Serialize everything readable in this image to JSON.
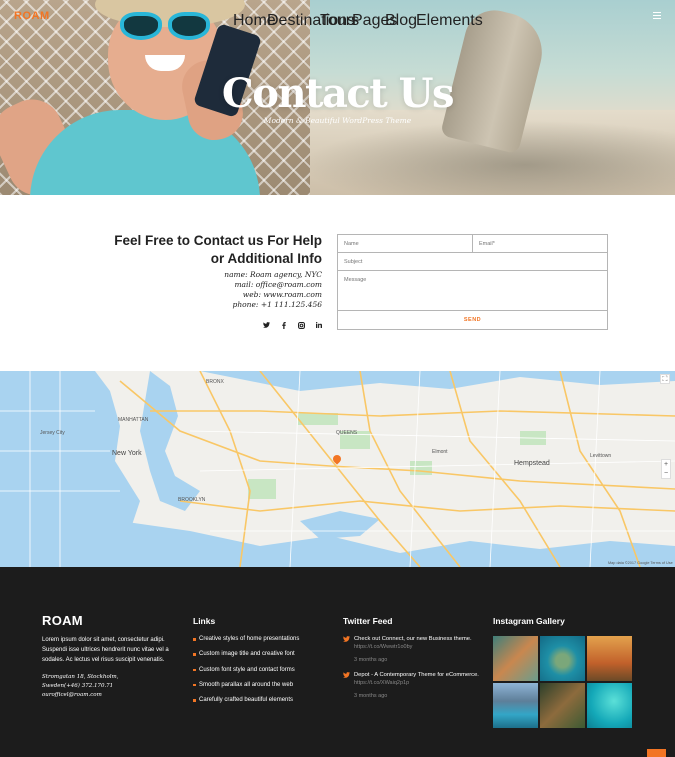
{
  "brand": {
    "logo": "ROAM",
    "accent": "#f27524"
  },
  "nav": {
    "items": [
      "Home",
      "Destinations",
      "Tours",
      "Pages",
      "Blog",
      "Elements"
    ]
  },
  "hero": {
    "title": "Contact Us",
    "subtitle": "Modern & Beautiful WordPress Theme"
  },
  "contact": {
    "heading_line1": "Feel Free to Contact us For Help",
    "heading_line2": "or Additional Info",
    "info": [
      "name: Roam agency, NYC",
      "mail: office@roam.com",
      "web: www.roam.com",
      "phone: +1 111.125.456"
    ],
    "socials": [
      "twitter-icon",
      "facebook-icon",
      "instagram-icon",
      "linkedin-icon"
    ],
    "form": {
      "name_placeholder": "Name",
      "email_placeholder": "Email*",
      "subject_placeholder": "Subject",
      "message_placeholder": "Message",
      "send_label": "SEND"
    }
  },
  "map": {
    "labels": [
      "New York",
      "Jersey City",
      "BROOKLYN",
      "QUEENS",
      "MANHATTAN",
      "BRONX",
      "Hempstead",
      "Levittown",
      "Elmont"
    ],
    "credit": "Map data ©2017 Google   Terms of Use",
    "zoom_in": "+",
    "zoom_out": "−"
  },
  "footer": {
    "logo": "ROAM",
    "text": "Lorem ipsum dolor sit amet, consectetur adipi. Suspendi isse ultrices hendrerit nunc vitae vel a sodales. Ac lectus vel risus suscipit venenatis.",
    "address": [
      "Stromgatan 18, Stockholm,",
      "Sweden(+46) 372.170.71",
      "ourofficel@roam.com"
    ],
    "links_title": "Links",
    "links": [
      "Creative styles of home presentations",
      "Custom image title and creative font",
      "Custom font style and contact forms",
      "Smooth parallax all around the web",
      "Carefully crafted beautiful elements"
    ],
    "twitter_title": "Twitter Feed",
    "tweets": [
      {
        "text": "Check out Connect, our new Business theme.",
        "url": "https://t.co/Wwwtr1o0by",
        "ago": "3 months ago"
      },
      {
        "text": "Depot - A Contemporary Theme for eCommerce.",
        "url": "https://t.co/XWaiq2p1p",
        "ago": "3 months ago"
      }
    ],
    "instagram_title": "Instagram Gallery"
  }
}
